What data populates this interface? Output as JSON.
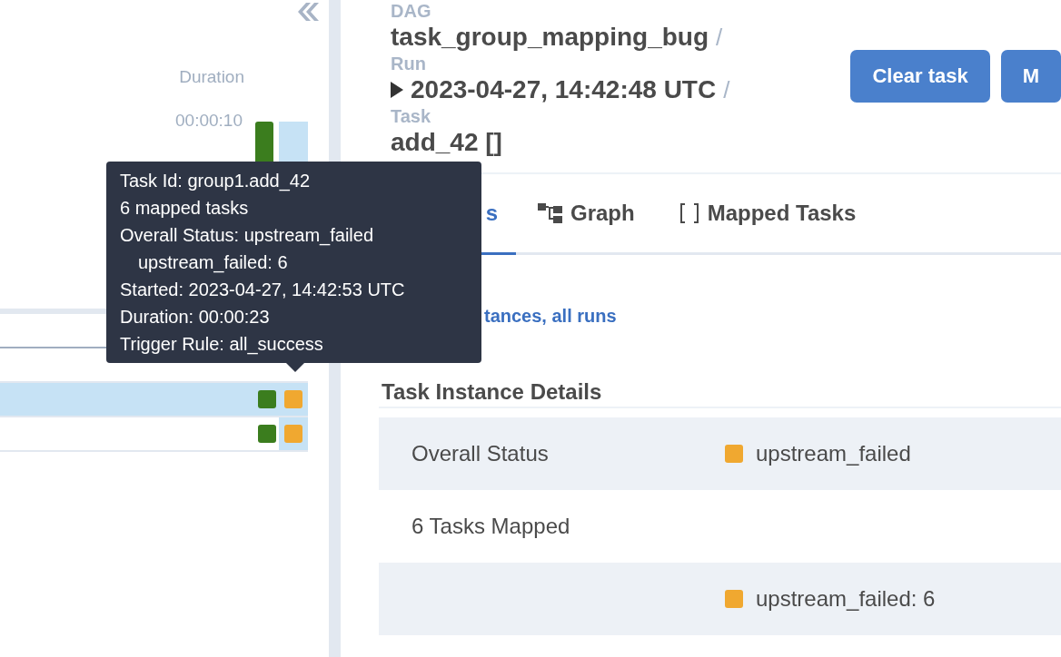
{
  "grid": {
    "duration_label": "Duration",
    "duration_tick": "00:00:10",
    "run_bars": [
      {
        "color": "#3b7d1e",
        "selected": false
      },
      {
        "color": "#c6e2f5",
        "selected": true
      }
    ],
    "rows": [
      {
        "selected": false,
        "cells": []
      },
      {
        "selected": false,
        "cells": []
      },
      {
        "selected": true,
        "cells": [
          {
            "color": "#3b7d1e"
          },
          {
            "color": "#f0a830"
          }
        ]
      },
      {
        "selected": false,
        "cells": [
          {
            "color": "#3b7d1e"
          },
          {
            "color": "#f0a830"
          }
        ]
      }
    ]
  },
  "breadcrumb": [
    {
      "label": "DAG",
      "value": "task_group_mapping_bug",
      "kind": "plain",
      "separator": "/"
    },
    {
      "label": "Run",
      "value": "2023-04-27, 14:42:48 UTC",
      "kind": "run",
      "separator": "/"
    },
    {
      "label": "Task",
      "value": "add_42 []",
      "kind": "plain"
    }
  ],
  "buttons": [
    "Clear task",
    "M"
  ],
  "tabs": [
    {
      "label": "s",
      "kind": "plain",
      "selected": true
    },
    {
      "label": "Graph",
      "kind": "graph",
      "selected": false
    },
    {
      "label": "Mapped Tasks",
      "kind": "mapped",
      "selected": false
    }
  ],
  "link": "tances, all runs",
  "section_title": "Task Instance Details",
  "details": [
    {
      "label": "Overall Status",
      "value": "upstream_failed",
      "color": "#f0a830"
    },
    {
      "label": "6 Tasks Mapped"
    },
    {
      "value": "upstream_failed: 6",
      "color": "#f0a830"
    }
  ],
  "tooltip": [
    "Task Id: group1.add_42",
    "6 mapped tasks",
    "Overall Status: upstream_failed",
    "upstream_failed: 6",
    "Started: 2023-04-27, 14:42:53 UTC",
    "Duration: 00:00:23",
    "Trigger Rule: all_success"
  ]
}
